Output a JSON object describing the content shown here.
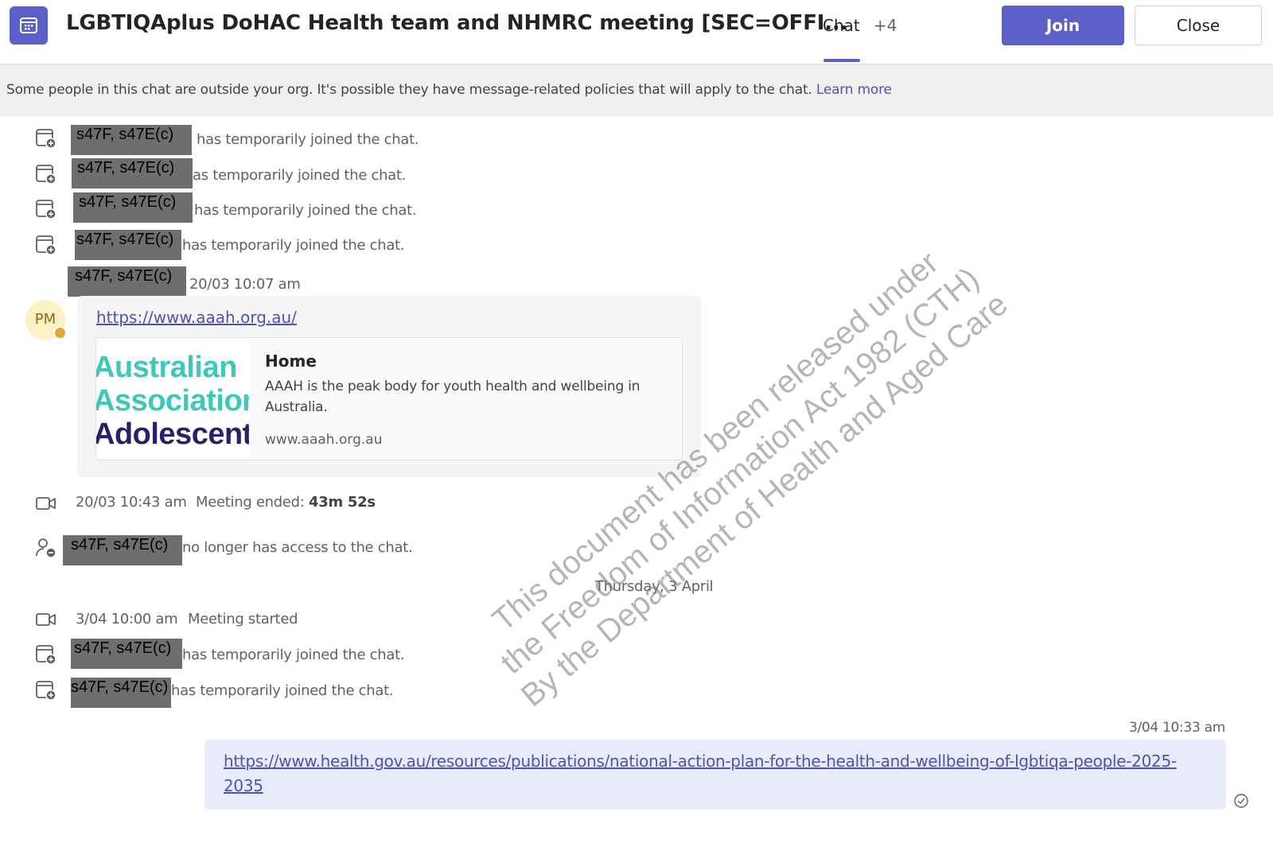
{
  "header": {
    "icon": "calendar-meeting-icon",
    "title": "LGBTIQAplus DoHAC Health team and NHMRC meeting [SEC=OFFI...",
    "tab_chat": "Chat",
    "tab_more": "+4",
    "join_label": "Join",
    "close_label": "Close",
    "accent_color": "#5b5fc7"
  },
  "banner": {
    "text": "Some people in this chat are outside your org. It's possible they have message-related policies that will apply to the chat.",
    "link": "Learn more"
  },
  "redaction_label": "s47F, s47E(c)",
  "events_top": [
    {
      "icon": "user-joined-icon",
      "text": "has temporarily joined the chat."
    },
    {
      "icon": "user-joined-icon",
      "text": "as temporarily joined the chat."
    },
    {
      "icon": "user-joined-icon",
      "text": "has temporarily joined the chat."
    },
    {
      "icon": "user-joined-icon",
      "text": "has temporarily joined the chat."
    }
  ],
  "message": {
    "timestamp": "20/03 10:07 am",
    "avatar_initials": "PM",
    "link": "https://www.aaah.org.au/",
    "preview": {
      "logo_lines": [
        "Australian",
        "Association",
        "Adolescent"
      ],
      "title": "Home",
      "description": "AAAH is the peak body for youth health and wellbeing in Australia.",
      "url": "www.aaah.org.au"
    }
  },
  "meeting_ended_1": {
    "time": "20/03 10:43 am",
    "label": "Meeting ended:",
    "duration": "43m 52s"
  },
  "no_access_text": "no longer has access to the chat.",
  "day_divider": "Thursday, 3 April",
  "meeting_started": {
    "time": "3/04 10:00 am",
    "label": "Meeting started"
  },
  "events_bottom": [
    {
      "icon": "user-joined-icon",
      "text": "has temporarily joined the chat."
    },
    {
      "icon": "user-joined-icon",
      "text": "has temporarily joined the chat."
    }
  ],
  "sent_message": {
    "timestamp": "3/04 10:33 am",
    "link": "https://www.health.gov.au/resources/publications/national-action-plan-for-the-health-and-wellbeing-of-lgbtiqa-people-2025-2035",
    "status_icon": "read-receipt-icon"
  },
  "watermark": [
    "This document has been released under",
    "the Freedom of Information Act 1982 (CTH)",
    "By the Department of Health and Aged Care"
  ]
}
